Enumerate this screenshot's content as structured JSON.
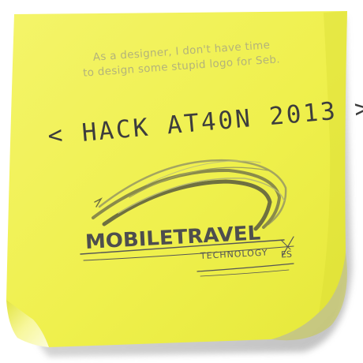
{
  "note": {
    "caption_line1": "As a designer, I don't have time",
    "caption_line2": "to design some stupid logo for Seb.",
    "hackathon_text": "< HACK AT40N 2013 >",
    "logo": {
      "wordmark": "MOBILETRAVEL",
      "subtitle": "TECHNOLOGY",
      "subtitle_alt": "ES"
    }
  },
  "colors": {
    "note_yellow": "#f2f25a",
    "note_shadow": "#a9a9a9",
    "curl_light": "#fbfbc4",
    "ink_dark": "#3d3d3d",
    "ink_pencil": "#b3b37a"
  }
}
